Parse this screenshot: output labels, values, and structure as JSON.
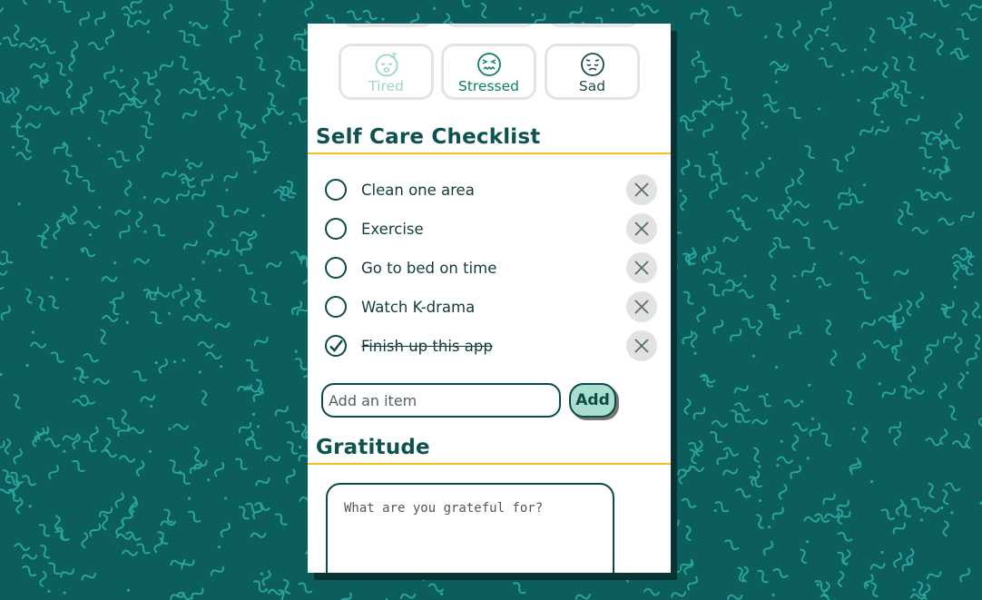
{
  "colors": {
    "background": "#0b5e5b",
    "squiggle": "#2aa59b",
    "heading": "#0b5250",
    "accent_rule": "#f2c21b",
    "add_button_fill": "#a9ddcf"
  },
  "moods": [
    {
      "label": "Tired",
      "icon": "sleepy-face-icon",
      "state": "faded"
    },
    {
      "label": "Stressed",
      "icon": "stressed-face-icon",
      "state": "active"
    },
    {
      "label": "Sad",
      "icon": "sad-face-icon",
      "state": "normal"
    }
  ],
  "checklist": {
    "title": "Self Care Checklist",
    "items": [
      {
        "label": "Clean one area",
        "done": false
      },
      {
        "label": "Exercise",
        "done": false
      },
      {
        "label": "Go to bed on time",
        "done": false
      },
      {
        "label": "Watch K-drama",
        "done": false
      },
      {
        "label": "Finish up this app",
        "done": true
      }
    ],
    "add_placeholder": "Add an item",
    "add_button": "Add"
  },
  "gratitude": {
    "title": "Gratitude",
    "placeholder": "What are you grateful for?"
  }
}
